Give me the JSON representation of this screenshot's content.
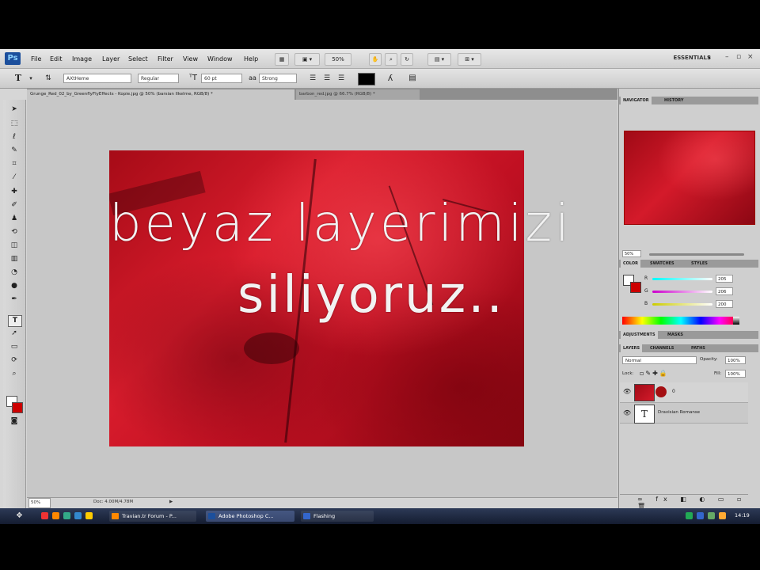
{
  "menu": {
    "logo": "Ps",
    "items": [
      "File",
      "Edit",
      "Image",
      "Layer",
      "Select",
      "Filter",
      "View",
      "Window",
      "Help"
    ],
    "zoom": "50%",
    "workspace": "ESSENTIALS"
  },
  "options": {
    "tool_icon": "T",
    "font_family": "AXtHeme",
    "font_style": "Regular",
    "font_size": "60 pt",
    "aa_label": "aa",
    "antialias": "Strong",
    "text_color": "#000000"
  },
  "tabs": [
    {
      "label": "Grunge_Red_02_by_GreenflyFlyEffects - Kopie.jpg @ 50% (barsian Ilkelme, RGB/8) *"
    },
    {
      "label": "barbon_red.jpg @ 66.7% (RGB/8) *"
    }
  ],
  "canvas": {
    "line1": "beyaz layerimizi",
    "line2": "siliyoruz.."
  },
  "status": {
    "zoom": "50%",
    "doc": "Doc: 4.00M/4.78M"
  },
  "panels": {
    "navigator_tabs": [
      "NAVIGATOR",
      "HISTORY"
    ],
    "nav_zoom": "50%",
    "color_tabs": [
      "COLOR",
      "SWATCHES",
      "STYLES"
    ],
    "color_values": {
      "r": "205",
      "g": "206",
      "b": "200"
    },
    "color_labels": {
      "r": "R",
      "g": "G",
      "b": "B"
    },
    "adjust_tabs": [
      "ADJUSTMENTS",
      "MASKS"
    ],
    "layer_tabs": [
      "LAYERS",
      "CHANNELS",
      "PATHS"
    ],
    "blend_mode": "Normal",
    "opacity_label": "Opacity:",
    "opacity": "100%",
    "lock_label": "Lock:",
    "fill_label": "Fill:",
    "fill": "100%",
    "layers": [
      {
        "name": "0",
        "type": "image"
      },
      {
        "name": "Dravisian Romanse",
        "type": "text",
        "thumb": "T"
      }
    ]
  },
  "taskbar": {
    "items": [
      "Travian.tr Forum - P...",
      "Adobe Photoshop C...",
      "Flashing"
    ],
    "clock": "14:19"
  }
}
